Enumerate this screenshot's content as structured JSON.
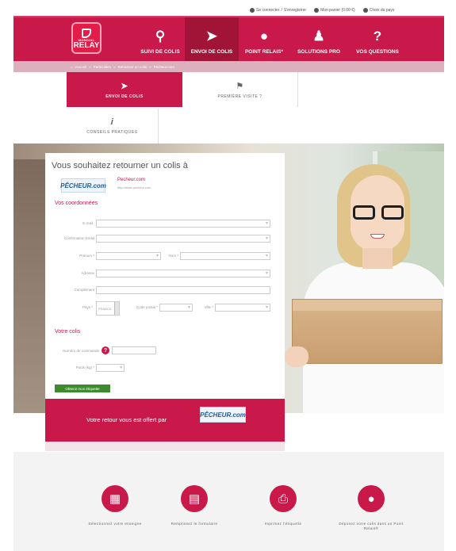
{
  "top_links": {
    "login": "Se connecter",
    "separator": "/",
    "register": "S'enregistrer",
    "cart": "Mon panier (0.00 €)",
    "country": "Choix du pays"
  },
  "nav": {
    "logo_small": "MONDIAL",
    "logo_big": "RELAY",
    "items": [
      {
        "label": "SUIVI DE COLIS",
        "icon": "search-icon",
        "glyph": "⚲"
      },
      {
        "label": "ENVOI DE COLIS",
        "icon": "paper-plane-icon",
        "glyph": "➤"
      },
      {
        "label": "POINT RELAIS*",
        "icon": "map-pin-icon",
        "glyph": "●"
      },
      {
        "label": "SOLUTIONS PRO",
        "icon": "business-person-icon",
        "glyph": "♟"
      },
      {
        "label": "VOS QUESTIONS",
        "icon": "question-mark-icon",
        "glyph": "?"
      }
    ]
  },
  "breadcrumb": [
    "Accueil",
    "Particuliers",
    "Retourner un colis",
    "Pêcheur.com"
  ],
  "subtabs": [
    {
      "label": "ENVOI DE COLIS",
      "glyph": "➤",
      "icon": "paper-plane-icon"
    },
    {
      "label": "PREMIÈRE VISITE ?",
      "glyph": "⚑",
      "icon": "flag-icon"
    },
    {
      "label": "CONSEILS PRATIQUES",
      "glyph": "i",
      "icon": "info-icon"
    }
  ],
  "form": {
    "title": "Vous souhaitez retourner un colis à",
    "merchant_logo": "PÊCHEUR.com",
    "merchant_name": "Pecheur.com",
    "merchant_url": "http://www.pecheur.com",
    "coords_title": "Vos coordonnées",
    "labels": {
      "email": "E-mail",
      "email_confirm": "Confirmation Email",
      "firstname": "Prénom *",
      "lastname": "Nom *",
      "address": "Adresse",
      "complement": "Complément",
      "country": "Pays *",
      "postcode": "Code postal *",
      "city": "Ville *"
    },
    "country_value": "FRANCE",
    "colis_title": "Votre colis",
    "order_label": "Numéro de commande",
    "weight_label": "Poids (kg) *",
    "submit": "Obtenir mon étiquette"
  },
  "promo": {
    "text": "Votre retour vous est offert par",
    "logo": "PÊCHEUR.com"
  },
  "steps": [
    {
      "label": "Sélectionnez votre enseigne",
      "icon": "storefront-icon",
      "glyph": "▦"
    },
    {
      "label": "Remplissez le formulaire",
      "icon": "clipboard-icon",
      "glyph": "▤"
    },
    {
      "label": "Imprimez l'étiquette",
      "icon": "printer-icon",
      "glyph": "⎙"
    },
    {
      "label": "Déposez votre colis dans un Point Relais®",
      "icon": "map-pin-icon",
      "glyph": "●"
    }
  ],
  "colors": {
    "brand": "#c8194a",
    "brand_dark": "#a11438",
    "submit_green": "#3c8b2e"
  }
}
